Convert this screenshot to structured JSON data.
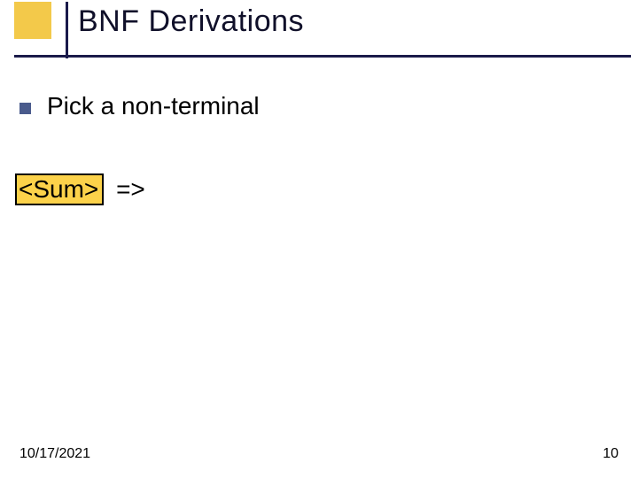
{
  "slide": {
    "title": "BNF Derivations",
    "bullet": "Pick a non-terminal",
    "derivation": {
      "boxed": "<Sum>",
      "arrow": "=>"
    },
    "footer": {
      "date": "10/17/2021",
      "page": "10"
    }
  }
}
